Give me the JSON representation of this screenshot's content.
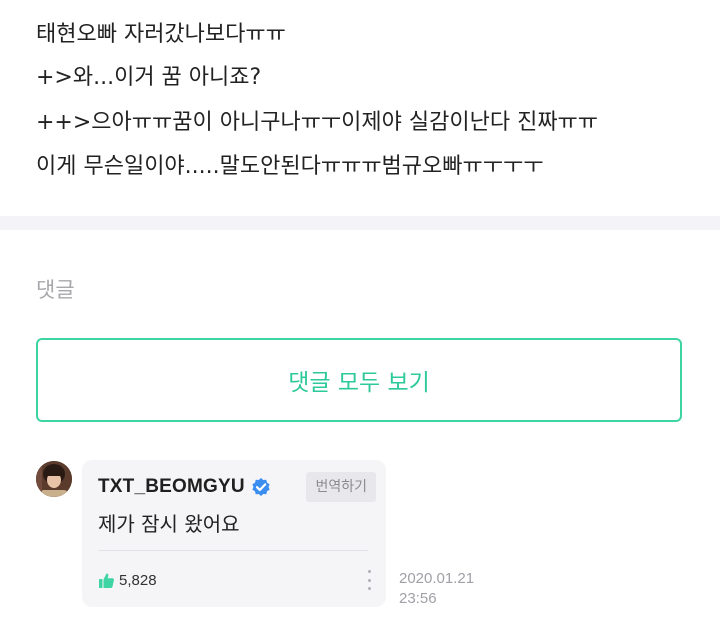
{
  "post": {
    "lines": [
      "태현오빠 자러갔나보다ㅠㅠ",
      "+>와...이거 꿈 아니죠?",
      "++>으아ㅠㅠ꿈이 아니구나ㅠㅜ이제야 실감이난다 진짜ㅠㅠ",
      "이게 무슨일이야.....말도안된다ㅠㅠㅠ범규오빠ㅠㅜㅜㅜ"
    ]
  },
  "comments": {
    "heading": "댓글",
    "view_all_label": "댓글 모두 보기",
    "items": [
      {
        "author": "TXT_BEOMGYU",
        "verified": true,
        "translate_label": "번역하기",
        "text": "제가 잠시 왔어요",
        "likes": "5,828",
        "date": "2020.01.21",
        "time": "23:56",
        "avatar_icon": "user-photo",
        "verified_icon": "verified-check-icon",
        "like_icon": "thumbs-up-icon",
        "more_icon": "more-vertical-icon"
      }
    ]
  },
  "colors": {
    "accent": "#2ec99a",
    "border_accent": "#3fd4a4",
    "verified": "#3b8df0",
    "like": "#3fd4a4"
  }
}
